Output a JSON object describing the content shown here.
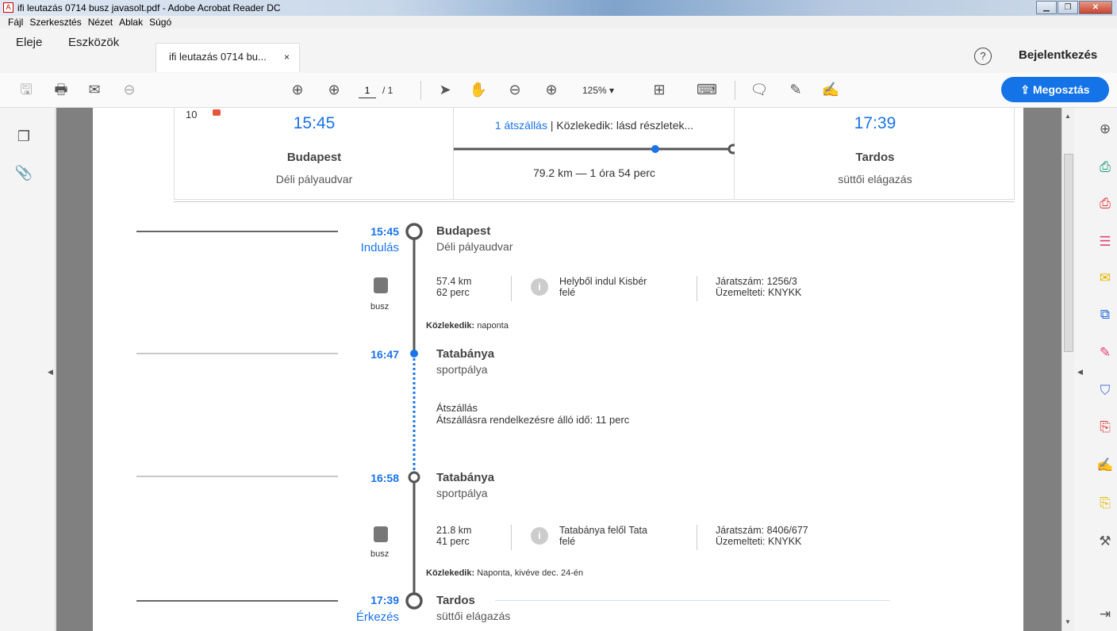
{
  "window": {
    "title": "ifi leutazás 0714 busz javasolt.pdf - Adobe Acrobat Reader DC"
  },
  "menu": [
    "Fájl",
    "Szerkesztés",
    "Nézet",
    "Ablak",
    "Súgó"
  ],
  "tabs": {
    "home": "Eleje",
    "tools": "Eszközök",
    "doc": "ifi leutazás 0714 bu...",
    "close": "×"
  },
  "header": {
    "help": "?",
    "login": "Bejelentkezés"
  },
  "toolbar": {
    "page_current": "1",
    "page_total": "/ 1",
    "zoom": "125%",
    "zoom_arrow": "▾",
    "share": "Megosztás"
  },
  "summary": {
    "route_num": "10",
    "dep_time": "15:45",
    "dep_city": "Budapest",
    "dep_stop": "Déli pályaudvar",
    "transfer_link": "1 átszállás",
    "transfer_rest": " | Közlekedik: lásd részletek...",
    "distance": "79.2 km — 1 óra 54 perc",
    "arr_time": "17:39",
    "arr_city": "Tardos",
    "arr_stop": "süttői elágazás"
  },
  "timeline": {
    "s1": {
      "time": "15:45",
      "sub": "Indulás",
      "place": "Budapest",
      "desc": "Déli pályaudvar"
    },
    "leg1": {
      "mode": "busz",
      "km": "57.4 km",
      "min": "62 perc",
      "info1": "Helyből indul Kisbér",
      "info2": "felé",
      "trip": "Járatszám: 1256/3",
      "op": "Üzemelteti: KNYKK",
      "runs_label": "Közlekedik:",
      "runs": " naponta"
    },
    "s2": {
      "time": "16:47",
      "place": "Tatabánya",
      "desc": "sportpálya"
    },
    "transfer": {
      "title": "Átszállás",
      "detail": "Átszállásra rendelkezésre álló idő: 11 perc"
    },
    "s3": {
      "time": "16:58",
      "place": "Tatabánya",
      "desc": "sportpálya"
    },
    "leg2": {
      "mode": "busz",
      "km": "21.8 km",
      "min": "41 perc",
      "info1": "Tatabánya felől Tata",
      "info2": "felé",
      "trip": "Járatszám: 8406/677",
      "op": "Üzemelteti: KNYKK",
      "runs_label": "Közlekedik:",
      "runs": " Naponta, kivéve dec. 24-én"
    },
    "s4": {
      "time": "17:39",
      "sub": "Érkezés",
      "place": "Tardos",
      "desc": "süttői elágazás"
    }
  },
  "icons": [
    "pdf-icon",
    "save-icon",
    "print-icon",
    "mail-icon",
    "zoom-search-icon",
    "up-icon",
    "down-icon",
    "cursor-icon",
    "hand-icon",
    "zoom-out-icon",
    "zoom-in-icon",
    "fit-icon",
    "keyboard-icon",
    "comment-icon",
    "highlight-icon",
    "sign-icon",
    "share-icon",
    "pages-icon",
    "attachment-icon",
    "bus-icon",
    "info-icon"
  ],
  "colors": {
    "accent": "#1473e6",
    "link": "#1a73e8"
  }
}
